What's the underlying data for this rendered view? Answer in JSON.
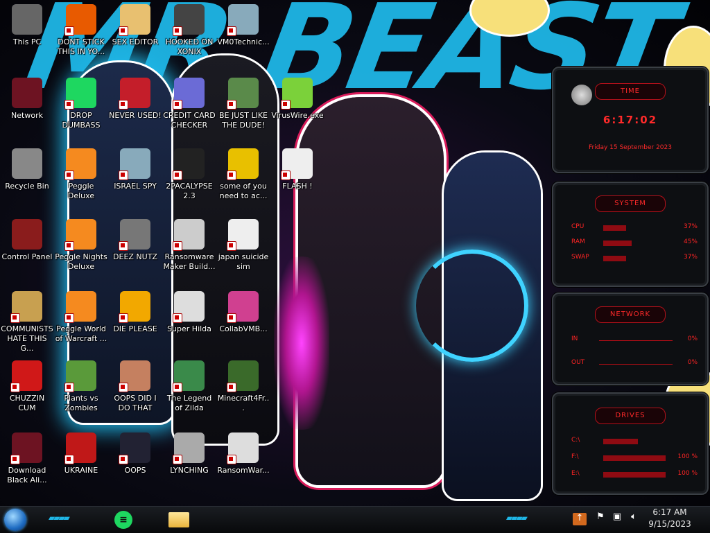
{
  "wallpaper": {
    "headline": "MR BEAST"
  },
  "desktop_icons": [
    {
      "label": "This PC"
    },
    {
      "label": "DONT STICK THIS IN YO..."
    },
    {
      "label": "SEX EDITOR"
    },
    {
      "label": "HOOKED ON XONIX"
    },
    {
      "label": "VM0Technic..."
    },
    {
      "label": "Network"
    },
    {
      "label": "DROP DUMBASS"
    },
    {
      "label": "NEVER USED!"
    },
    {
      "label": "CREDIT CARD CHECKER"
    },
    {
      "label": "BE JUST LIKE THE DUDE!"
    },
    {
      "label": "VirusWire.exe"
    },
    {
      "label": "Recycle Bin"
    },
    {
      "label": "Peggle Deluxe"
    },
    {
      "label": "ISRAEL SPY"
    },
    {
      "label": "2PACALYPSE 2.3"
    },
    {
      "label": "some of you need to ac..."
    },
    {
      "label": "FLASH !"
    },
    {
      "label": "Control Panel"
    },
    {
      "label": "Peggle Nights Deluxe"
    },
    {
      "label": "DEEZ NUTZ"
    },
    {
      "label": "Ransomware Maker Build..."
    },
    {
      "label": "japan suicide sim"
    },
    {
      "label": "COMMUNISTS HATE THIS G..."
    },
    {
      "label": "Peggle World of Warcraft ..."
    },
    {
      "label": "DIE PLEASE"
    },
    {
      "label": "Super Hilda"
    },
    {
      "label": "CollabVMB..."
    },
    {
      "label": "CHUZZIN CUM"
    },
    {
      "label": "Plants vs Zombies"
    },
    {
      "label": "OOPS DID I DO THAT"
    },
    {
      "label": "The Legend of Zilda"
    },
    {
      "label": "Minecraft4Fr..."
    },
    {
      "label": "Download Black Ali..."
    },
    {
      "label": "UKRAINE"
    },
    {
      "label": "OOPS"
    },
    {
      "label": "LYNCHING"
    },
    {
      "label": "RansomWar..."
    }
  ],
  "widgets": {
    "time": {
      "title": "TIME",
      "clock": "6:17:02",
      "date": "Friday 15 September 2023"
    },
    "system": {
      "title": "SYSTEM",
      "rows": [
        {
          "label": "CPU",
          "pct": "37%",
          "level": 0.37
        },
        {
          "label": "RAM",
          "pct": "45%",
          "level": 0.45
        },
        {
          "label": "SWAP",
          "pct": "37%",
          "level": 0.37
        }
      ]
    },
    "network": {
      "title": "NETWORK",
      "rows": [
        {
          "label": "IN",
          "pct": "0%"
        },
        {
          "label": "OUT",
          "pct": "0%"
        }
      ]
    },
    "drives": {
      "title": "DRIVES",
      "rows": [
        {
          "label": "C:\\",
          "pct": "",
          "level": 0.55
        },
        {
          "label": "F:\\",
          "pct": "100 %",
          "level": 1.0
        },
        {
          "label": "E:\\",
          "pct": "100 %",
          "level": 1.0
        }
      ]
    }
  },
  "taskbar": {
    "time": "6:17 AM",
    "date": "9/15/2023",
    "accent": "#1fb6e6"
  }
}
